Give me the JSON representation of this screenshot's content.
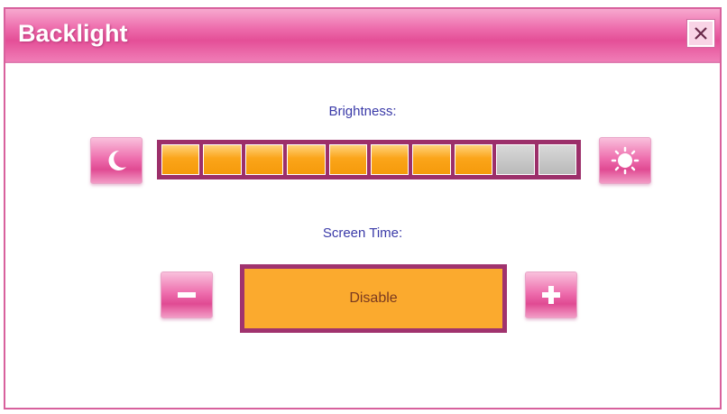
{
  "window": {
    "title": "Backlight",
    "close_icon": "close-icon"
  },
  "brightness": {
    "label": "Brightness:",
    "level": 8,
    "max": 10,
    "decrease_icon": "moon-icon",
    "increase_icon": "sun-icon"
  },
  "screen_time": {
    "label": "Screen Time:",
    "value": "Disable",
    "decrease_icon": "minus-icon",
    "increase_icon": "plus-icon"
  },
  "colors": {
    "accent": "#e44f97",
    "segment_on": "#fba51a",
    "segment_off": "#bdbdbd",
    "label_text": "#3a3aa8"
  }
}
